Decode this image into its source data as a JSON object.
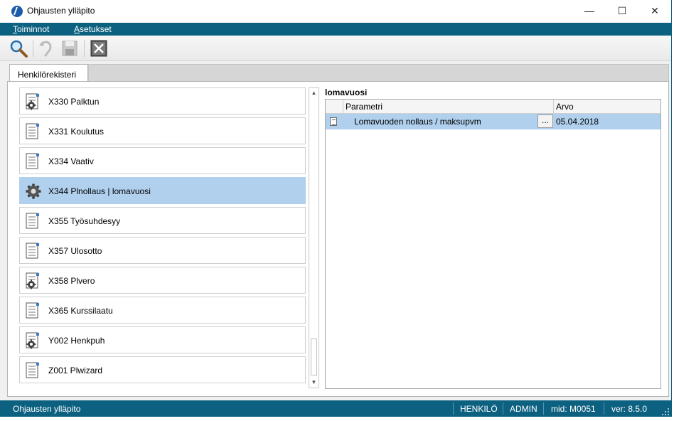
{
  "window": {
    "title": "Ohjausten ylläpito",
    "controls": {
      "minimize": "—",
      "maximize": "☐",
      "close": "✕"
    }
  },
  "menu": [
    {
      "hotkey": "T",
      "rest": "oiminnot"
    },
    {
      "hotkey": "A",
      "rest": "setukset"
    }
  ],
  "toolbar": {
    "buttons": [
      "search-icon",
      "undo-icon",
      "save-icon",
      "close-box-icon"
    ]
  },
  "tabs": {
    "active": "Henkilörekisteri"
  },
  "list": {
    "items": [
      {
        "label": "X330 Palktun",
        "icon": "document-gear-icon",
        "selected": false
      },
      {
        "label": "X331 Koulutus",
        "icon": "document-icon",
        "selected": false
      },
      {
        "label": "X334 Vaativ",
        "icon": "document-icon",
        "selected": false
      },
      {
        "label": "X344 Plnollaus | lomavuosi",
        "icon": "gear-icon",
        "selected": true
      },
      {
        "label": "X355 Työsuhdesyy",
        "icon": "document-icon",
        "selected": false
      },
      {
        "label": "X357 Ulosotto",
        "icon": "document-icon",
        "selected": false
      },
      {
        "label": "X358 Plvero",
        "icon": "document-gear-icon",
        "selected": false
      },
      {
        "label": "X365 Kurssilaatu",
        "icon": "document-icon",
        "selected": false
      },
      {
        "label": "Y002 Henkpuh",
        "icon": "document-gear-icon",
        "selected": false
      },
      {
        "label": "Z001 Plwizard",
        "icon": "document-icon",
        "selected": false
      }
    ]
  },
  "scrollbar": {
    "up": "▲",
    "down": "▼"
  },
  "grid": {
    "title": "lomavuosi",
    "columns": [
      "Parametri",
      "Arvo"
    ],
    "rows": [
      {
        "parameter": "Lomavuoden nollaus / maksupvm",
        "button": "...",
        "value": "05.04.2018"
      }
    ]
  },
  "status": {
    "left": "Ohjausten ylläpito",
    "fields": [
      "HENKILÖ",
      "ADMIN",
      "mid: M0051",
      "ver: 8.5.0"
    ]
  },
  "colors": {
    "accent": "#0d6180",
    "selection": "#b0d0ee"
  }
}
